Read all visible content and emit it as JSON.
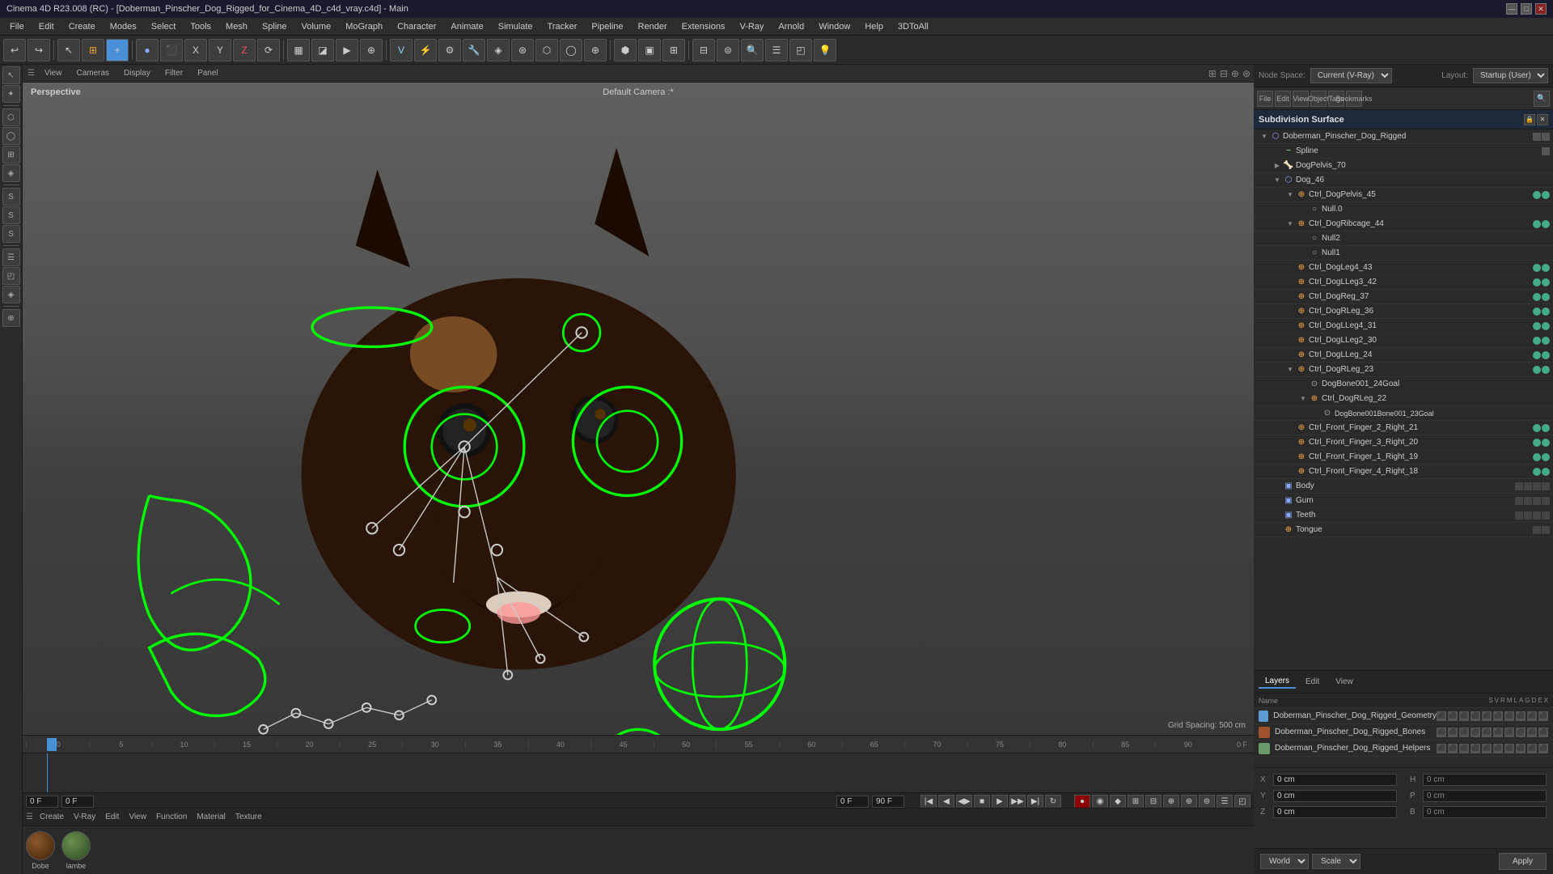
{
  "titlebar": {
    "title": "Cinema 4D R23.008 (RC) - [Doberman_Pinscher_Dog_Rigged_for_Cinema_4D_c4d_vray.c4d] - Main",
    "minimize": "—",
    "maximize": "□",
    "close": "✕"
  },
  "menubar": {
    "items": [
      "File",
      "Edit",
      "Create",
      "Modes",
      "Select",
      "Tools",
      "Mesh",
      "Spline",
      "Volume",
      "MoGraph",
      "Character",
      "Animate",
      "Simulate",
      "Tracker",
      "Pipeline",
      "Render",
      "Extensions",
      "V-Ray",
      "Arnold",
      "Window",
      "Help",
      "3DToAll"
    ]
  },
  "viewport": {
    "mode": "Perspective",
    "camera": "Default Camera",
    "tabs": [
      "View",
      "Cameras",
      "Display",
      "Filter",
      "Panel"
    ],
    "grid_spacing": "Grid Spacing: 500 cm"
  },
  "right_panel": {
    "node_space_label": "Node Space:",
    "node_space_value": "Current (V-Ray)",
    "layout_label": "Layout:",
    "layout_value": "Startup (User)",
    "manager_tabs": [
      "File",
      "Edit",
      "View",
      "Object",
      "Tags",
      "Bookmarks"
    ],
    "subd_title": "Subdivision Surface"
  },
  "object_tree": {
    "items": [
      {
        "name": "Subdivision Surface",
        "level": 0,
        "type": "subd",
        "has_children": true,
        "color": "blue"
      },
      {
        "name": "Doberman_Pinscher_Dog_Rigged",
        "level": 1,
        "type": "obj",
        "has_children": true,
        "color": "none"
      },
      {
        "name": "Spline",
        "level": 2,
        "type": "spline",
        "has_children": false,
        "color": "none"
      },
      {
        "name": "DogPelvis_70",
        "level": 2,
        "type": "bone",
        "has_children": true,
        "color": "none"
      },
      {
        "name": "Dog_46",
        "level": 2,
        "type": "obj",
        "has_children": true,
        "color": "none"
      },
      {
        "name": "Ctrl_DogPelvis_45",
        "level": 3,
        "type": "ctrl",
        "has_children": true,
        "color": "green"
      },
      {
        "name": "Null.0",
        "level": 4,
        "type": "null",
        "has_children": false,
        "color": "none"
      },
      {
        "name": "Ctrl_DogRibcage_44",
        "level": 3,
        "type": "ctrl",
        "has_children": true,
        "color": "green"
      },
      {
        "name": "Null2",
        "level": 4,
        "type": "null",
        "has_children": false,
        "color": "none"
      },
      {
        "name": "Null1",
        "level": 4,
        "type": "null",
        "has_children": false,
        "color": "none"
      },
      {
        "name": "Ctrl_DogLeg4_43",
        "level": 3,
        "type": "ctrl",
        "has_children": false,
        "color": "green"
      },
      {
        "name": "Ctrl_DogLLeg3_42",
        "level": 3,
        "type": "ctrl",
        "has_children": false,
        "color": "green"
      },
      {
        "name": "Ctrl_DogReg_37",
        "level": 3,
        "type": "ctrl",
        "has_children": false,
        "color": "green"
      },
      {
        "name": "Ctrl_DogRLeg_36",
        "level": 3,
        "type": "ctrl",
        "has_children": false,
        "color": "green"
      },
      {
        "name": "Ctrl_DogLLeg4_31",
        "level": 3,
        "type": "ctrl",
        "has_children": false,
        "color": "green"
      },
      {
        "name": "Ctrl_DogLLeg2_30",
        "level": 3,
        "type": "ctrl",
        "has_children": false,
        "color": "green"
      },
      {
        "name": "Ctrl_DogLLeg_24",
        "level": 3,
        "type": "ctrl",
        "has_children": false,
        "color": "green"
      },
      {
        "name": "Ctrl_DogRLeg_23",
        "level": 3,
        "type": "ctrl",
        "has_children": true,
        "color": "green"
      },
      {
        "name": "DogBone001_24Goal",
        "level": 4,
        "type": "goal",
        "has_children": false,
        "color": "none"
      },
      {
        "name": "Ctrl_DogRLeg_22",
        "level": 4,
        "type": "ctrl",
        "has_children": true,
        "color": "none"
      },
      {
        "name": "DogBone001Bone001_23Goal",
        "level": 5,
        "type": "goal",
        "has_children": false,
        "color": "none"
      },
      {
        "name": "Ctrl_Front_Finger_2_Right_21",
        "level": 3,
        "type": "ctrl",
        "has_children": false,
        "color": "green"
      },
      {
        "name": "Ctrl_Front_Finger_3_Right_20",
        "level": 3,
        "type": "ctrl",
        "has_children": false,
        "color": "green"
      },
      {
        "name": "Ctrl_Front_Finger_1_Right_19",
        "level": 3,
        "type": "ctrl",
        "has_children": false,
        "color": "green"
      },
      {
        "name": "Ctrl_Front_Finger_4_Right_18",
        "level": 3,
        "type": "ctrl",
        "has_children": false,
        "color": "green"
      },
      {
        "name": "Body",
        "level": 2,
        "type": "mesh",
        "has_children": false,
        "color": "none"
      },
      {
        "name": "Gum",
        "level": 2,
        "type": "mesh",
        "has_children": false,
        "color": "none"
      },
      {
        "name": "Teeth",
        "level": 2,
        "type": "mesh",
        "has_children": false,
        "color": "none"
      },
      {
        "name": "Tongue",
        "level": 2,
        "type": "mesh",
        "has_children": false,
        "color": "none"
      }
    ]
  },
  "layers": {
    "tabs": [
      "Layers",
      "Edit",
      "View"
    ],
    "items": [
      {
        "name": "Doberman_Pinscher_Dog_Rigged_Geometry",
        "color": "#5a9bd3"
      },
      {
        "name": "Doberman_Pinscher_Dog_Rigged_Bones",
        "color": "#a0522d"
      },
      {
        "name": "Doberman_Pinscher_Dog_Rigged_Helpers",
        "color": "#6a9a6a"
      }
    ]
  },
  "coordinates": {
    "x_label": "X",
    "x_val": "0 cm",
    "y_label": "Y",
    "y_val": "0 cm",
    "z_label": "Z",
    "z_val": "0 cm",
    "h_label": "H",
    "h_val": "0 cm",
    "p_label": "P",
    "p_val": "0 cm",
    "b_label": "B",
    "b_val": "0 cm",
    "size_x_val": "0 cm",
    "size_y_val": "0 cm",
    "size_z_val": "0 cm"
  },
  "apply_bar": {
    "world_label": "World",
    "scale_label": "Scale",
    "apply_label": "Apply"
  },
  "timeline": {
    "frame_current": "0 F",
    "frame_start": "0 F",
    "frame_end": "90 F",
    "frame_end2": "90 F",
    "marks": [
      "0",
      "5",
      "10",
      "15",
      "20",
      "25",
      "30",
      "35",
      "40",
      "45",
      "50",
      "55",
      "60",
      "65",
      "70",
      "75",
      "80",
      "85",
      "90"
    ],
    "current_frame_display": "0 F"
  },
  "materials": [
    {
      "name": "Dobe",
      "color": "#8B4513"
    },
    {
      "name": "lambe",
      "color": "#4a9050"
    }
  ],
  "mat_bar_menus": [
    "Create",
    "V-Ray",
    "Edit",
    "View",
    "Function",
    "Material",
    "Texture"
  ],
  "left_tools": [
    "↖",
    "✦",
    "⟳",
    "⟲",
    "⤢",
    "⊞",
    "⊟",
    "∷",
    "◯",
    "⬡",
    "◈",
    "☰",
    "⊕"
  ],
  "toolbar_icons": [
    "↩",
    "↪",
    "↖",
    "⊞",
    "+",
    "◉",
    "🔲",
    "X",
    "Y",
    "Z",
    "⟳",
    "▦",
    "◪",
    "▶",
    "⊕",
    "⚡",
    "⚙",
    "🔧",
    "🗂",
    "🔺",
    "⬡",
    "⊛",
    "⊕",
    "✦",
    "⊠",
    "⊟",
    "⟦",
    "⟧",
    "▣",
    "◈",
    "⊜",
    "⚐",
    "🔍",
    "☰",
    "◰",
    "⊕",
    "💡"
  ]
}
